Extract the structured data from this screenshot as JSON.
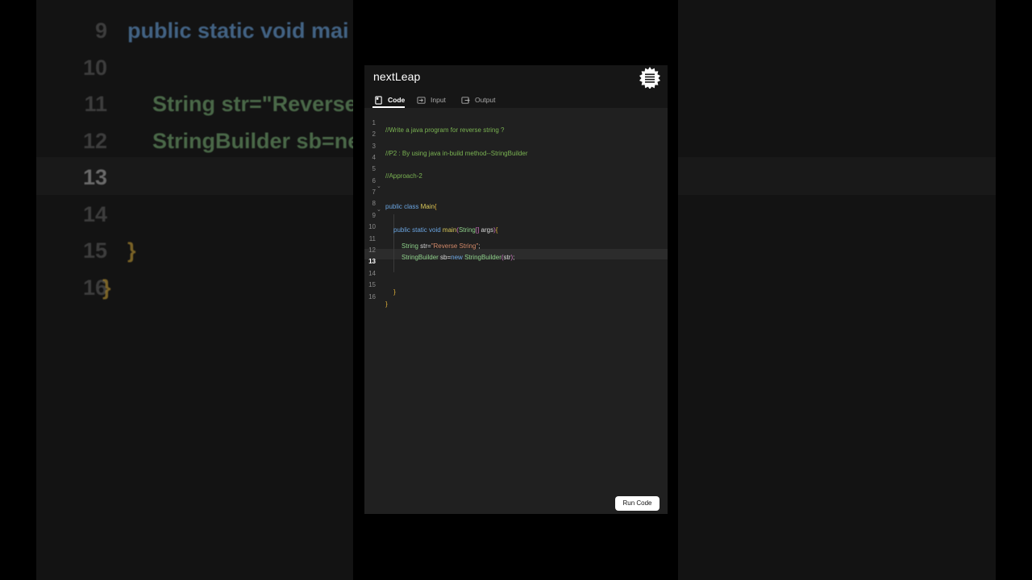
{
  "app": {
    "brand": "nextLeap",
    "menu_icon": "menu-icon"
  },
  "tabs": [
    {
      "label": "Code",
      "icon": "code-file-icon",
      "active": true
    },
    {
      "label": "Input",
      "icon": "input-icon",
      "active": false
    },
    {
      "label": "Output",
      "icon": "output-icon",
      "active": false
    }
  ],
  "editor": {
    "current_line": 13,
    "lines": [
      {
        "n": "1",
        "text": "//Write a java program for reverse string ?"
      },
      {
        "n": "2",
        "text": ""
      },
      {
        "n": "3",
        "text": "//P2 : By using java in-build method--StringBuilder"
      },
      {
        "n": "4",
        "text": ""
      },
      {
        "n": "5",
        "text": "//Approach-2"
      },
      {
        "n": "6",
        "text": ""
      },
      {
        "n": "7",
        "text": "public class Main{"
      },
      {
        "n": "8",
        "text": ""
      },
      {
        "n": "9",
        "text": "public static void main(String[] args){"
      },
      {
        "n": "10",
        "text": ""
      },
      {
        "n": "11",
        "text": "String str=\"Reverse String\";"
      },
      {
        "n": "12",
        "text": "StringBuilder sb=new StringBuilder(str);"
      },
      {
        "n": "13",
        "text": ""
      },
      {
        "n": "14",
        "text": ""
      },
      {
        "n": "15",
        "text": "}"
      },
      {
        "n": "16",
        "text": "}"
      }
    ],
    "tokens": {
      "l1": "//Write a java program for reverse string ?",
      "l3": "//P2 : By using java in-build method--StringBuilder",
      "l5": "//Approach-2",
      "l7_kw": "public class ",
      "l7_cls": "Main",
      "l7_br": "{",
      "l9_kw": "public static void ",
      "l9_fn": "main",
      "l9_p1": "(",
      "l9_type": "String",
      "l9_arr": "[]",
      "l9_args": " args",
      "l9_p2": ")",
      "l9_br": "{",
      "l11_type": "String",
      "l11_txt": " str=",
      "l11_str": "\"Reverse String\"",
      "l11_end": ";",
      "l12_type": "StringBuilder",
      "l12_txt": " sb=",
      "l12_kw": "new ",
      "l12_type2": "StringBuilder",
      "l12_p1": "(",
      "l12_arg": "str",
      "l12_p2": ")",
      "l12_end": ";",
      "l15": "}",
      "l16": "}"
    }
  },
  "run_button": {
    "label": "Run Code"
  },
  "background": {
    "lines": [
      {
        "n": "9",
        "code": "public static void mai"
      },
      {
        "n": "10",
        "code": ""
      },
      {
        "n": "11",
        "code": "String str=\"Reverse"
      },
      {
        "n": "12",
        "code": "StringBuilder sb=ne"
      },
      {
        "n": "13",
        "code": ""
      },
      {
        "n": "14",
        "code": ""
      },
      {
        "n": "15",
        "code": "}"
      },
      {
        "n": "16",
        "code": "}"
      }
    ]
  },
  "colors": {
    "comment": "#7ab352",
    "keyword": "#6aa4e0",
    "class": "#d8c75a",
    "type": "#8ed08a",
    "string": "#d48a6a",
    "editor_bg": "#202020",
    "header_bg": "#161616"
  }
}
